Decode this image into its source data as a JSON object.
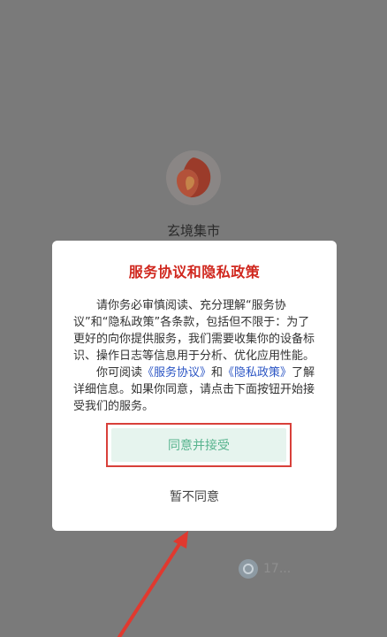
{
  "app": {
    "name": "玄境集市",
    "logo_icon": "phoenix-logo-icon"
  },
  "dialog": {
    "title": "服务协议和隐私政策",
    "para1": "请你务必审慎阅读、充分理解“服务协议”和“隐私政策”各条款，包括但不限于：为了更好的向你提供服务，我们需要收集你的设备标识、操作日志等信息用于分析、优化应用性能。",
    "para2_prefix": "你可阅读",
    "service_link": "《服务协议》",
    "para2_and": "和",
    "privacy_link": "《隐私政策》",
    "para2_suffix": "了解详细信息。如果你同意，请点击下面按钮开始接受我们的服务。",
    "agree_label": "同意并接受",
    "disagree_label": "暂不同意"
  },
  "watermark": {
    "text": "17...",
    "icon": "watermark-badge-icon"
  },
  "colors": {
    "overlay": "#7a7a7a",
    "title_red": "#d0281f",
    "link_blue": "#2b55c4",
    "agree_green": "#59b48f",
    "highlight_red": "#d8403a"
  }
}
